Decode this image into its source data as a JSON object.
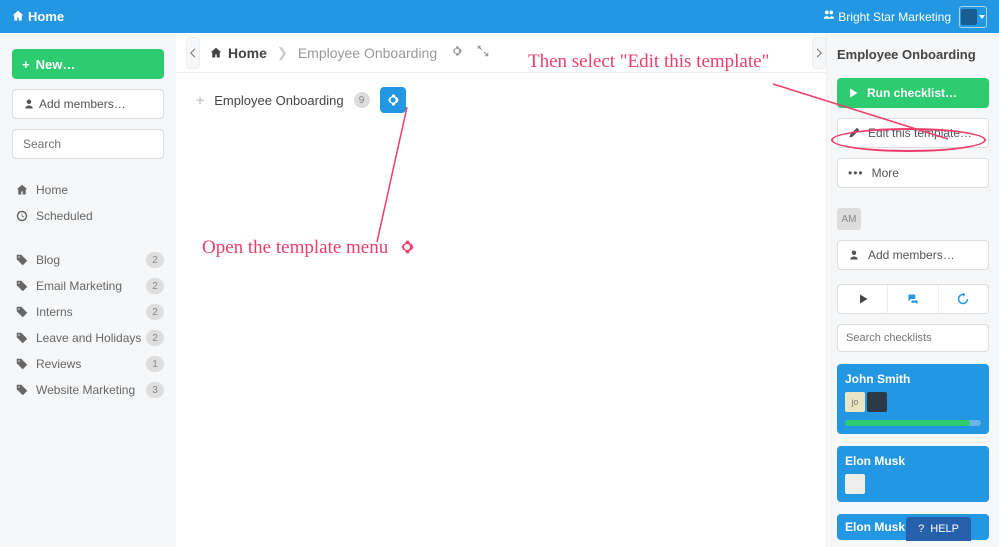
{
  "topbar": {
    "home": "Home",
    "org": "Bright Star Marketing"
  },
  "sidebar": {
    "new_label": "New…",
    "add_members": "Add members…",
    "search_placeholder": "Search",
    "links": [
      {
        "label": "Home",
        "icon": "home"
      },
      {
        "label": "Scheduled",
        "icon": "clock"
      }
    ],
    "tags": [
      {
        "label": "Blog",
        "count": "2"
      },
      {
        "label": "Email Marketing",
        "count": "2"
      },
      {
        "label": "Interns",
        "count": "2"
      },
      {
        "label": "Leave and Holidays",
        "count": "2"
      },
      {
        "label": "Reviews",
        "count": "1"
      },
      {
        "label": "Website Marketing",
        "count": "3"
      }
    ]
  },
  "breadcrumb": {
    "home": "Home",
    "current": "Employee Onboarding"
  },
  "content": {
    "template_name": "Employee Onboarding",
    "count": "9"
  },
  "rightpanel": {
    "title": "Employee Onboarding",
    "run_label": "Run checklist…",
    "edit_label": "Edit this template…",
    "more_label": "More",
    "am_badge": "AM",
    "add_members": "Add members…",
    "search_placeholder": "Search checklists",
    "cards": [
      {
        "name": "John Smith",
        "progress": 92,
        "avatars": [
          "jo",
          "dark"
        ]
      },
      {
        "name": "Elon Musk",
        "progress": 0,
        "avatars": [
          "white"
        ]
      },
      {
        "name": "Elon Musk",
        "progress": 0,
        "avatars": []
      }
    ]
  },
  "help": "HELP",
  "annotations": {
    "open_menu": "Open the template menu",
    "select_edit": "Then select \"Edit this template\""
  }
}
